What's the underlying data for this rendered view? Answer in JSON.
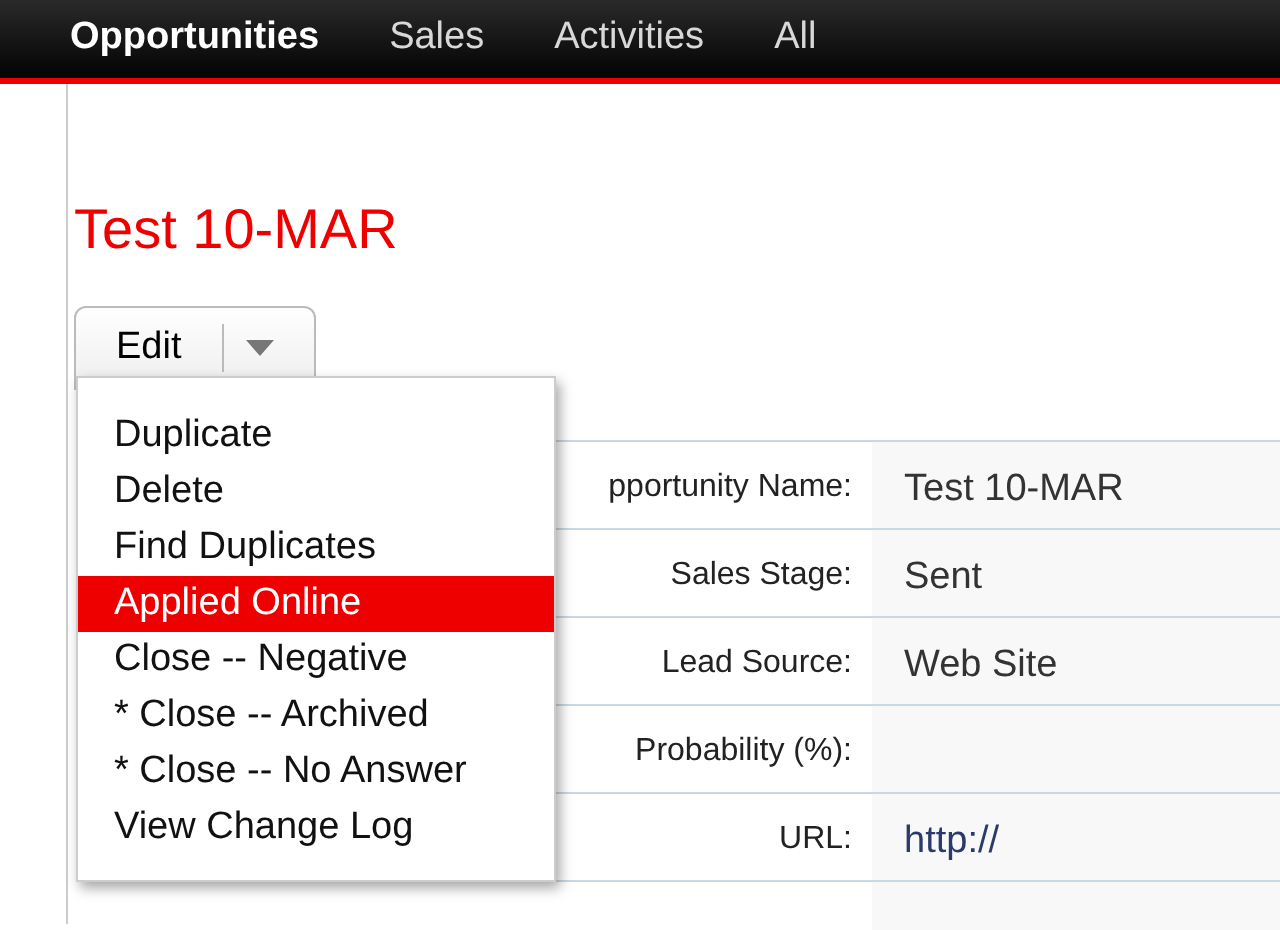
{
  "nav": [
    {
      "label": "Opportunities",
      "selected": true
    },
    {
      "label": "Sales",
      "selected": false
    },
    {
      "label": "Activities",
      "selected": false
    },
    {
      "label": "All",
      "selected": false
    }
  ],
  "title": "Test 10-MAR",
  "edit_button": {
    "label": "Edit"
  },
  "menu": [
    {
      "label": "Duplicate",
      "selected": false
    },
    {
      "label": "Delete",
      "selected": false
    },
    {
      "label": "Find Duplicates",
      "selected": false
    },
    {
      "label": "Applied Online",
      "selected": true
    },
    {
      "label": "Close -- Negative",
      "selected": false
    },
    {
      "label": "* Close -- Archived",
      "selected": false
    },
    {
      "label": "* Close -- No Answer",
      "selected": false
    },
    {
      "label": "View Change Log",
      "selected": false
    }
  ],
  "fields": [
    {
      "label": "pportunity Name:",
      "value": "Test 10-MAR"
    },
    {
      "label": "Sales Stage:",
      "value": "Sent"
    },
    {
      "label": "Lead Source:",
      "value": "Web Site"
    },
    {
      "label": "Probability (%):"
    },
    {
      "label": "URL:",
      "value": "http://",
      "kind": "link"
    }
  ]
}
